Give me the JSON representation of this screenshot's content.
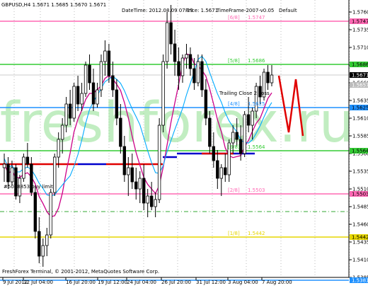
{
  "header": {
    "symbol_info": "GBPUSD,H4  1.5671 1.5685 1.5670 1.5671",
    "datetime": "DateTime: 2012.08.09 07:29",
    "price": "Price: 1.5671",
    "timeframe": "TimeFrame-2007-v0.05",
    "default": "Default"
  },
  "watermark": "freshforex.ru",
  "footer": "FreshForex Terminal, © 2001-2012, MetaQuotes Software Corp.",
  "ticket_label": "#5078853 buy limit",
  "stop_label": "Trailing Close 2 Loss",
  "colors": {
    "candle": "#000000",
    "murrey_pink": "#ff69b4",
    "murrey_green": "#33cc33",
    "murrey_cyan": "#1e90ff",
    "murrey_yellow": "#e6d600",
    "red_level": "#e00000",
    "blue_level": "#0000cc",
    "ma_magenta": "#cc0088",
    "ma_cyan": "#00aaff",
    "forecast": "#e00000",
    "watermark": "#8fe08f"
  },
  "chart_data": {
    "type": "candlestick",
    "ylim": [
      1.5385,
      1.5777
    ],
    "y_ticks": [
      "1.5760",
      "1.5735",
      "1.5710",
      "1.5685",
      "1.5660",
      "1.5635",
      "1.5610",
      "1.5585",
      "1.5560",
      "1.5535",
      "1.5510",
      "1.5485",
      "1.5460",
      "1.5435",
      "1.5410",
      "1.5385"
    ],
    "x_ticks": [
      "9 Jul 2012",
      "12 Jul 04:00",
      "16 Jul 20:00",
      "19 Jul 12:00",
      "24 Jul 04:00",
      "26 Jul 20:00",
      "31 Jul 12:00",
      "3 Aug 04:00",
      "7 Aug 20:00"
    ],
    "levels": [
      {
        "label": "[6/8]",
        "value": "1.5747",
        "color": "pink",
        "badge": "1.5747"
      },
      {
        "label": "[5/8]",
        "value": "1.5686",
        "color": "green",
        "badge": "1.5686"
      },
      {
        "label": "[4/8]",
        "value": "1.5625",
        "color": "cyan",
        "badge": "1.5625"
      },
      {
        "label": "[3/8]",
        "value": "1.5564",
        "color": "green",
        "badge": "1.5564"
      },
      {
        "label": "[2/8]",
        "value": "1.5503",
        "color": "pink",
        "badge": "1.5503"
      },
      {
        "label": "[1/8]",
        "value": "1.5442",
        "color": "yellow",
        "badge": "1.5442"
      }
    ],
    "current_price": "1.5671",
    "stop_badge": "1.5657",
    "bottom_badge": "1.5381",
    "candles": [
      [
        1.554,
        1.556,
        1.552,
        1.5545
      ],
      [
        1.5545,
        1.5555,
        1.551,
        1.552
      ],
      [
        1.552,
        1.555,
        1.5515,
        1.554
      ],
      [
        1.554,
        1.5545,
        1.5495,
        1.55
      ],
      [
        1.55,
        1.553,
        1.549,
        1.5525
      ],
      [
        1.5525,
        1.556,
        1.552,
        1.5555
      ],
      [
        1.5555,
        1.5575,
        1.554,
        1.5545
      ],
      [
        1.5545,
        1.5555,
        1.55,
        1.5505
      ],
      [
        1.5505,
        1.5515,
        1.544,
        1.545
      ],
      [
        1.545,
        1.547,
        1.5405,
        1.5415
      ],
      [
        1.5415,
        1.544,
        1.54,
        1.543
      ],
      [
        1.543,
        1.5455,
        1.5415,
        1.5445
      ],
      [
        1.5445,
        1.551,
        1.544,
        1.5505
      ],
      [
        1.5505,
        1.556,
        1.55,
        1.5555
      ],
      [
        1.5555,
        1.559,
        1.554,
        1.558
      ],
      [
        1.558,
        1.561,
        1.556,
        1.56
      ],
      [
        1.56,
        1.564,
        1.559,
        1.563
      ],
      [
        1.563,
        1.565,
        1.56,
        1.561
      ],
      [
        1.561,
        1.566,
        1.5605,
        1.5655
      ],
      [
        1.5655,
        1.567,
        1.562,
        1.563
      ],
      [
        1.563,
        1.566,
        1.562,
        1.5645
      ],
      [
        1.5645,
        1.569,
        1.564,
        1.5685
      ],
      [
        1.5685,
        1.57,
        1.565,
        1.566
      ],
      [
        1.566,
        1.568,
        1.562,
        1.563
      ],
      [
        1.563,
        1.566,
        1.5625,
        1.565
      ],
      [
        1.565,
        1.57,
        1.564,
        1.569
      ],
      [
        1.569,
        1.572,
        1.567,
        1.5705
      ],
      [
        1.5705,
        1.5715,
        1.566,
        1.567
      ],
      [
        1.567,
        1.569,
        1.564,
        1.565
      ],
      [
        1.565,
        1.5665,
        1.56,
        1.561
      ],
      [
        1.561,
        1.563,
        1.556,
        1.557
      ],
      [
        1.557,
        1.5585,
        1.552,
        1.553
      ],
      [
        1.553,
        1.5555,
        1.55,
        1.554
      ],
      [
        1.554,
        1.556,
        1.551,
        1.552
      ],
      [
        1.552,
        1.554,
        1.5495,
        1.551
      ],
      [
        1.551,
        1.5535,
        1.549,
        1.5525
      ],
      [
        1.5525,
        1.5545,
        1.548,
        1.549
      ],
      [
        1.549,
        1.551,
        1.547,
        1.55
      ],
      [
        1.55,
        1.552,
        1.548,
        1.5485
      ],
      [
        1.5485,
        1.5505,
        1.547,
        1.5495
      ],
      [
        1.5495,
        1.561,
        1.549,
        1.56
      ],
      [
        1.56,
        1.57,
        1.559,
        1.569
      ],
      [
        1.569,
        1.576,
        1.568,
        1.5745
      ],
      [
        1.5745,
        1.577,
        1.57,
        1.5715
      ],
      [
        1.5715,
        1.5735,
        1.567,
        1.569
      ],
      [
        1.569,
        1.571,
        1.565,
        1.567
      ],
      [
        1.567,
        1.57,
        1.566,
        1.5695
      ],
      [
        1.5695,
        1.5715,
        1.568,
        1.57
      ],
      [
        1.57,
        1.571,
        1.567,
        1.568
      ],
      [
        1.568,
        1.5695,
        1.565,
        1.566
      ],
      [
        1.566,
        1.57,
        1.5655,
        1.569
      ],
      [
        1.569,
        1.57,
        1.564,
        1.565
      ],
      [
        1.565,
        1.5665,
        1.56,
        1.561
      ],
      [
        1.561,
        1.562,
        1.556,
        1.557
      ],
      [
        1.557,
        1.559,
        1.554,
        1.555
      ],
      [
        1.555,
        1.5565,
        1.551,
        1.5525
      ],
      [
        1.5525,
        1.5545,
        1.55,
        1.554
      ],
      [
        1.554,
        1.556,
        1.552,
        1.553
      ],
      [
        1.553,
        1.558,
        1.552,
        1.5575
      ],
      [
        1.5575,
        1.56,
        1.556,
        1.559
      ],
      [
        1.559,
        1.561,
        1.557,
        1.558
      ],
      [
        1.558,
        1.56,
        1.555,
        1.556
      ],
      [
        1.556,
        1.562,
        1.5555,
        1.5615
      ],
      [
        1.5615,
        1.564,
        1.559,
        1.56
      ],
      [
        1.56,
        1.5625,
        1.558,
        1.562
      ],
      [
        1.562,
        1.566,
        1.561,
        1.5655
      ],
      [
        1.5655,
        1.567,
        1.563,
        1.564
      ],
      [
        1.564,
        1.568,
        1.5635,
        1.5675
      ],
      [
        1.5675,
        1.5685,
        1.565,
        1.566
      ],
      [
        1.566,
        1.5685,
        1.5655,
        1.5671
      ]
    ],
    "forecast_path": [
      [
        1.567
      ],
      [
        1.559
      ],
      [
        1.5665
      ],
      [
        1.5585
      ]
    ]
  }
}
